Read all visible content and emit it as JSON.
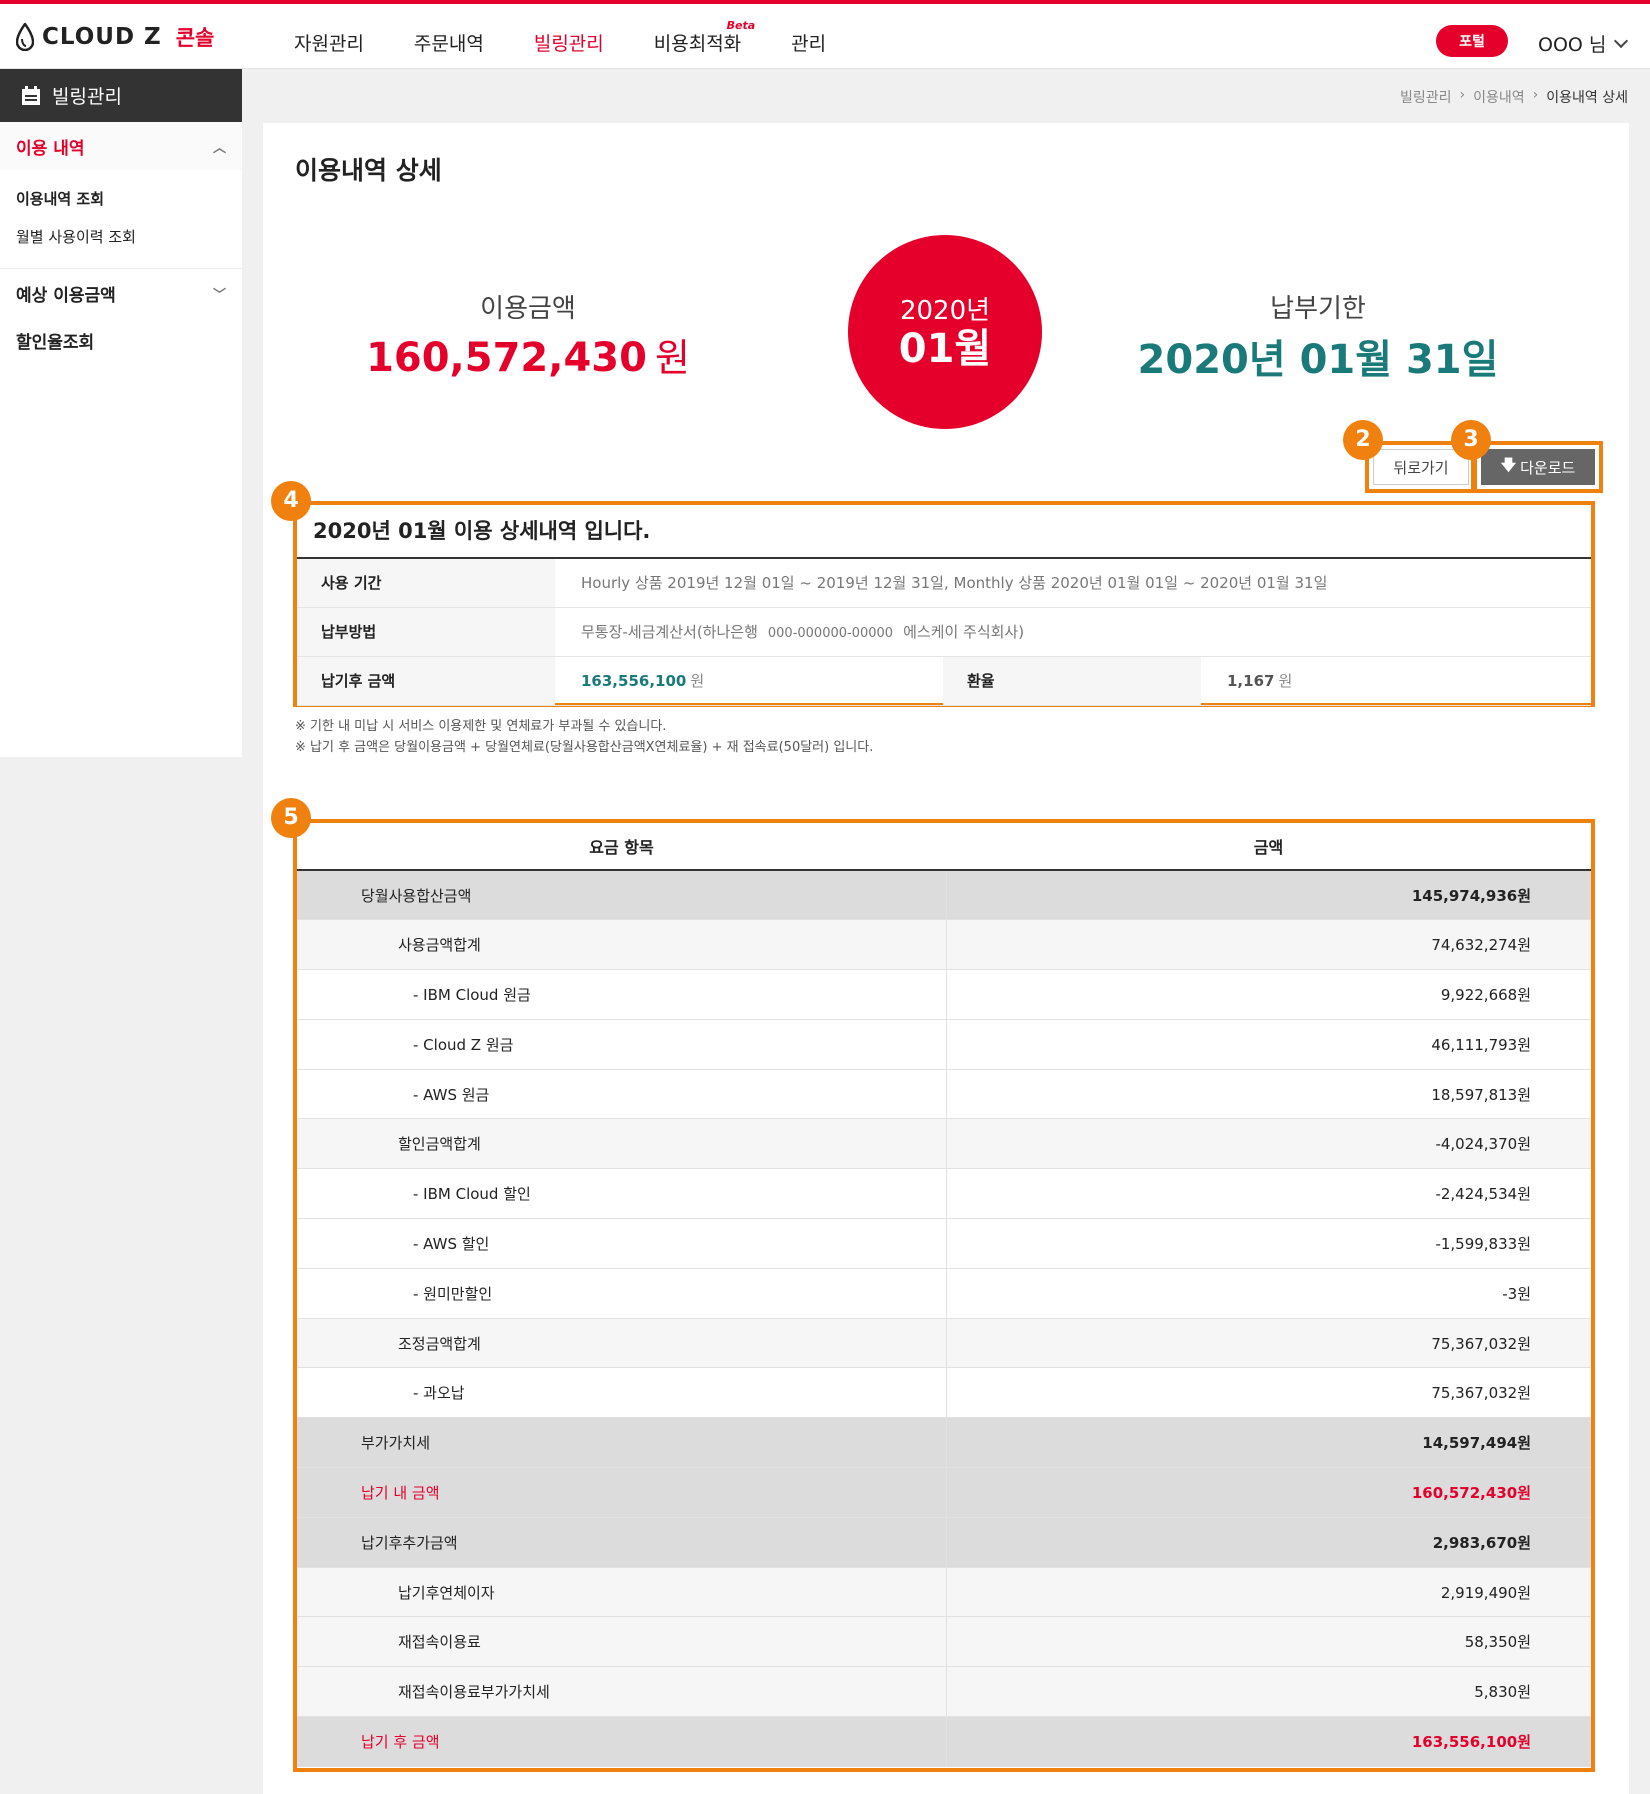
{
  "header": {
    "logo_brand": "CLOUD Z",
    "logo_console": "콘솔",
    "nav": [
      {
        "label": "자원관리",
        "active": false
      },
      {
        "label": "주문내역",
        "active": false
      },
      {
        "label": "빌링관리",
        "active": true
      },
      {
        "label": "비용최적화",
        "active": false,
        "badge": "Beta"
      },
      {
        "label": "관리",
        "active": false
      }
    ],
    "portal_label": "포털",
    "user_label": "OOO 님"
  },
  "sidebar": {
    "title": "빌링관리",
    "group1": "이용 내역",
    "sub_items": [
      "이용내역 조회",
      "월별 사용이력 조회"
    ],
    "group2": "예상 이용금액",
    "item3": "할인율조회"
  },
  "breadcrumb": [
    "빌링관리",
    "이용내역",
    "이용내역 상세"
  ],
  "page": {
    "title": "이용내역 상세",
    "usage_label": "이용금액",
    "usage_amount": "160,572,430",
    "usage_unit": "원",
    "circle_year": "2020년",
    "circle_month": "01월",
    "due_label": "납부기한",
    "due_date": "2020년 01월 31일",
    "back_label": "뒤로가기",
    "download_label": "다운로드",
    "badges": [
      "2",
      "3",
      "4",
      "5"
    ]
  },
  "info": {
    "title": "2020년 01월 이용 상세내역 입니다.",
    "period_label": "사용 기간",
    "period_value": "Hourly 상품 2019년 12월 01일 ~ 2019년 12월 31일, Monthly 상품 2020년 01월 01일 ~ 2020년 01월 31일",
    "payment_label": "납부방법",
    "payment_bank": "무통장-세금계산서(하나은행",
    "payment_account": "000-000000-00000",
    "payment_holder": "에스케이 주식회사)",
    "after_label": "납기후 금액",
    "after_amount": "163,556,100",
    "after_unit": "원",
    "rate_label": "환율",
    "rate_value": "1,167",
    "rate_unit": "원"
  },
  "notes": [
    "※ 기한 내 미납 시 서비스 이용제한 및 연체료가 부과될 수 있습니다.",
    "※ 납기 후 금액은 당월이용금액 + 당월연체료(당월사용합산금액X연체료율) + 재 접속료(50달러) 입니다."
  ],
  "fees": {
    "col_item": "요금 항목",
    "col_amount": "금액",
    "rows": [
      {
        "label": "당월사용합산금액",
        "amount": "145,974,936원",
        "level": 0
      },
      {
        "label": "사용금액합계",
        "amount": "74,632,274원",
        "level": 1
      },
      {
        "label": "- IBM Cloud 원금",
        "amount": "9,922,668원",
        "level": 2
      },
      {
        "label": "- Cloud Z 원금",
        "amount": "46,111,793원",
        "level": 2
      },
      {
        "label": "- AWS 원금",
        "amount": "18,597,813원",
        "level": 2
      },
      {
        "label": "할인금액합계",
        "amount": "-4,024,370원",
        "level": 1
      },
      {
        "label": "- IBM Cloud 할인",
        "amount": "-2,424,534원",
        "level": 2
      },
      {
        "label": "- AWS 할인",
        "amount": "-1,599,833원",
        "level": 2
      },
      {
        "label": "- 원미만할인",
        "amount": "-3원",
        "level": 2
      },
      {
        "label": "조정금액합계",
        "amount": "75,367,032원",
        "level": 1
      },
      {
        "label": "- 과오납",
        "amount": "75,367,032원",
        "level": 2
      },
      {
        "label": "부가가치세",
        "amount": "14,597,494원",
        "level": 0
      },
      {
        "label": "납기 내 금액",
        "amount": "160,572,430원",
        "level": 0,
        "red": true
      },
      {
        "label": "납기후추가금액",
        "amount": "2,983,670원",
        "level": 0
      },
      {
        "label": "납기후연체이자",
        "amount": "2,919,490원",
        "level": 1
      },
      {
        "label": "재접속이용료",
        "amount": "58,350원",
        "level": 1
      },
      {
        "label": "재접속이용료부가가치세",
        "amount": "5,830원",
        "level": 1
      },
      {
        "label": "납기 후 금액",
        "amount": "163,556,100원",
        "level": 0,
        "red": true
      }
    ]
  },
  "colors": {
    "brand_red": "#e4002b",
    "teal": "#1a7a7a",
    "highlight_orange": "#f0810f"
  }
}
